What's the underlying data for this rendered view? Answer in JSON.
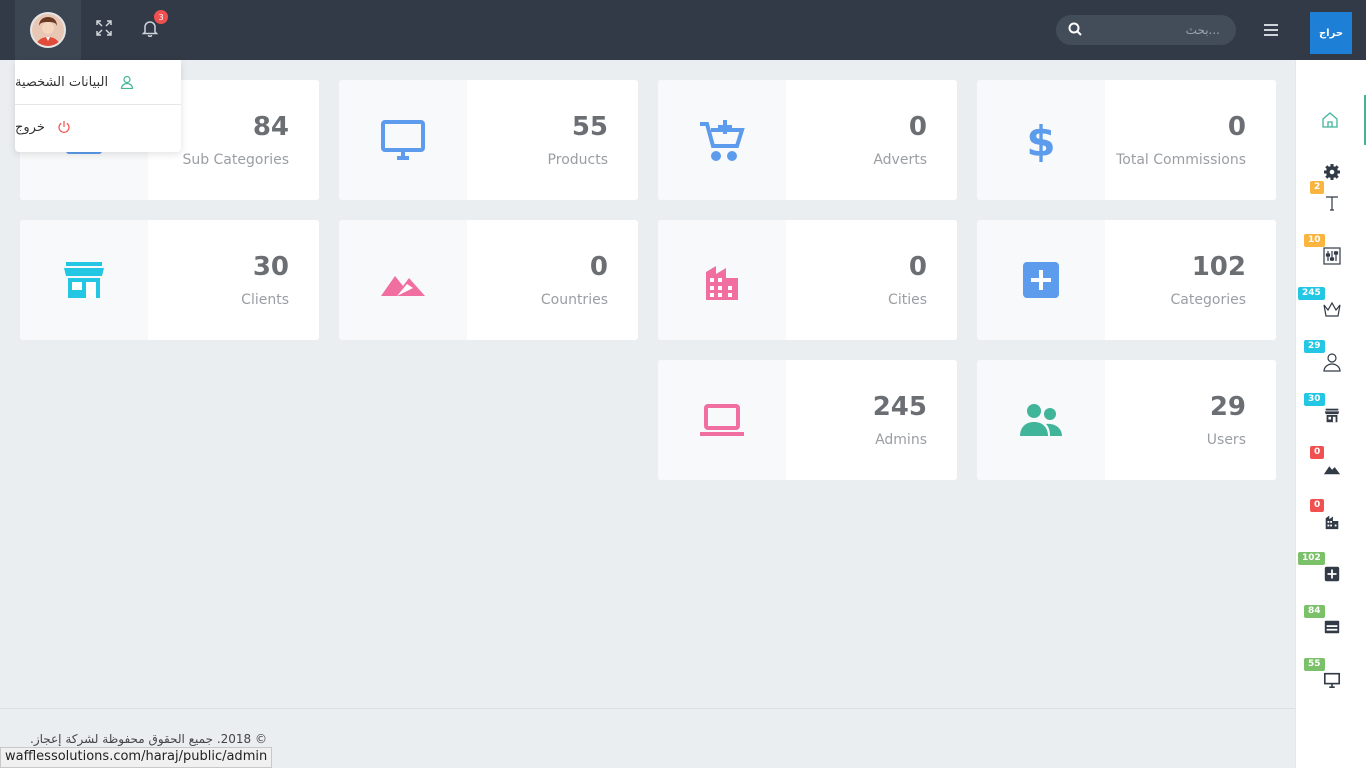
{
  "header": {
    "notification_count": "3",
    "search_placeholder": "بحث...",
    "logo_text": "حراج"
  },
  "user_menu": {
    "profile_label": "البيانات الشخصية",
    "logout_label": "خروج"
  },
  "cards": [
    {
      "value": "84",
      "label": "Sub Categories",
      "icon": "subcategory-icon",
      "color": "#5d9cec"
    },
    {
      "value": "55",
      "label": "Products",
      "icon": "monitor-icon",
      "color": "#5d9cec"
    },
    {
      "value": "0",
      "label": "Adverts",
      "icon": "cart-plus-icon",
      "color": "#5d9cec"
    },
    {
      "value": "0",
      "label": "Total Commissions",
      "icon": "dollar-icon",
      "color": "#5d9cec"
    },
    {
      "value": "30",
      "label": "Clients",
      "icon": "store-icon",
      "color": "#23c6e3"
    },
    {
      "value": "0",
      "label": "Countries",
      "icon": "mountain-icon",
      "color": "#f06ea0"
    },
    {
      "value": "0",
      "label": "Cities",
      "icon": "building-icon",
      "color": "#f06ea0"
    },
    {
      "value": "102",
      "label": "Categories",
      "icon": "plus-square-icon",
      "color": "#5d9cec"
    },
    {
      "value": "245",
      "label": "Admins",
      "icon": "laptop-icon",
      "color": "#f06ea0"
    },
    {
      "value": "29",
      "label": "Users",
      "icon": "users-icon",
      "color": "#41b59a"
    }
  ],
  "sidebar": {
    "badges": [
      {
        "value": "2",
        "color": "#f9b53f"
      },
      {
        "value": "10",
        "color": "#f9b53f"
      },
      {
        "value": "245",
        "color": "#23c6e3"
      },
      {
        "value": "29",
        "color": "#23c6e3"
      },
      {
        "value": "30",
        "color": "#23c6e3"
      },
      {
        "value": "0",
        "color": "#f05050"
      },
      {
        "value": "0",
        "color": "#f05050"
      },
      {
        "value": "102",
        "color": "#7ac16a"
      },
      {
        "value": "84",
        "color": "#7ac16a"
      },
      {
        "value": "55",
        "color": "#7ac16a"
      }
    ]
  },
  "footer": {
    "copyright": "© 2018. جميع الحقوق محفوظة لشركة إعجاز.",
    "status_url": "wafflessolutions.com/haraj/public/admin"
  },
  "colors": {
    "topbar": "#313a46",
    "accent": "#41b59a"
  }
}
